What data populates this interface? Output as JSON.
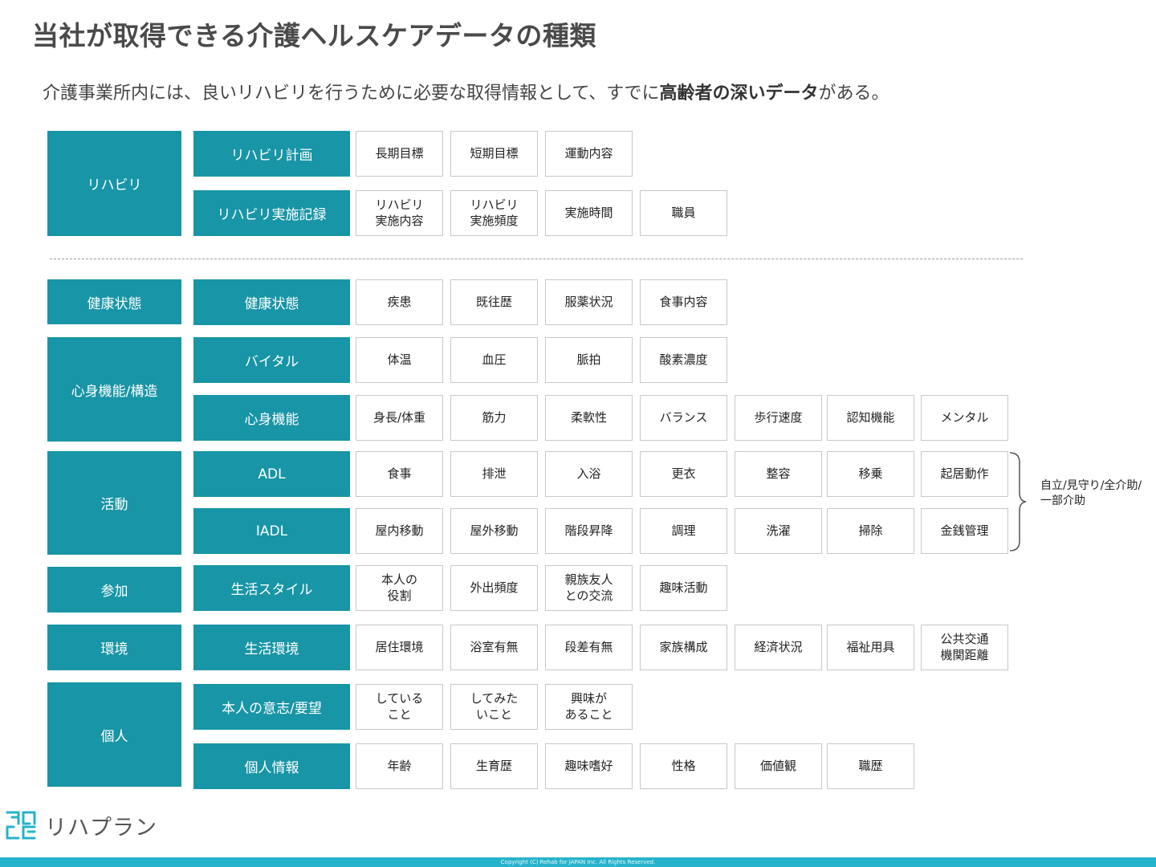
{
  "title": "当社が取得できる介護ヘルスケアデータの種類",
  "subtitle": {
    "pre": "介護事業所内には、良いリハビリを行うために必要な取得情報として、すでに",
    "bold": "高齢者の深いデータ",
    "post": "がある。"
  },
  "categories": [
    {
      "label": "リハビリ"
    },
    {
      "label": "健康状態"
    },
    {
      "label": "心身機能/構造"
    },
    {
      "label": "活動"
    },
    {
      "label": "参加"
    },
    {
      "label": "環境"
    },
    {
      "label": "個人"
    }
  ],
  "rows": [
    {
      "label": "リハビリ計画",
      "items": [
        "長期目標",
        "短期目標",
        "運動内容"
      ]
    },
    {
      "label": "リハビリ実施記録",
      "items": [
        "リハビリ\n実施内容",
        "リハビリ\n実施頻度",
        "実施時間",
        "職員"
      ]
    },
    {
      "label": "健康状態",
      "items": [
        "疾患",
        "既往歴",
        "服薬状況",
        "食事内容"
      ]
    },
    {
      "label": "バイタル",
      "items": [
        "体温",
        "血圧",
        "脈拍",
        "酸素濃度"
      ]
    },
    {
      "label": "心身機能",
      "items": [
        "身長/体重",
        "筋力",
        "柔軟性",
        "バランス",
        "歩行速度",
        "認知機能",
        "メンタル"
      ]
    },
    {
      "label": "ADL",
      "items": [
        "食事",
        "排泄",
        "入浴",
        "更衣",
        "整容",
        "移乗",
        "起居動作"
      ]
    },
    {
      "label": "IADL",
      "items": [
        "屋内移動",
        "屋外移動",
        "階段昇降",
        "調理",
        "洗濯",
        "掃除",
        "金銭管理"
      ]
    },
    {
      "label": "生活スタイル",
      "items": [
        "本人の\n役割",
        "外出頻度",
        "親族友人\nとの交流",
        "趣味活動"
      ]
    },
    {
      "label": "生活環境",
      "items": [
        "居住環境",
        "浴室有無",
        "段差有無",
        "家族構成",
        "経済状況",
        "福祉用具",
        "公共交通\n機関距離"
      ]
    },
    {
      "label": "本人の意志/要望",
      "items": [
        "している\nこと",
        "してみた\nいこと",
        "興味が\nあること"
      ]
    },
    {
      "label": "個人情報",
      "items": [
        "年齢",
        "生育歴",
        "趣味嗜好",
        "性格",
        "価値観",
        "職歴"
      ]
    }
  ],
  "brace_note": "自立/見守り/全介助/\n一部介助",
  "logo": {
    "text": "リハプラン",
    "icon": "rehaplan-logo-icon"
  },
  "footer": "Copyright (C) Rehab for JAPAN Inc. All Rights Reserved.",
  "colors": {
    "primary": "#1895a6",
    "footer": "#27b3cc"
  }
}
